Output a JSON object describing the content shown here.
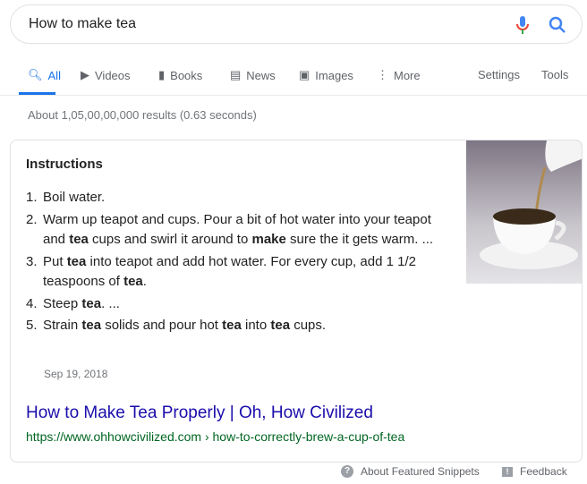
{
  "search": {
    "query": "How to make tea"
  },
  "tabs": [
    {
      "label": "All",
      "icon": "search-icon",
      "active": true
    },
    {
      "label": "Videos",
      "icon": "video-icon"
    },
    {
      "label": "Books",
      "icon": "book-icon"
    },
    {
      "label": "News",
      "icon": "news-icon"
    },
    {
      "label": "Images",
      "icon": "image-icon"
    },
    {
      "label": "More",
      "icon": "more-vert-icon"
    }
  ],
  "tools": {
    "settings": "Settings",
    "tools": "Tools"
  },
  "result_stats": "About 1,05,00,00,000 results (0.63 seconds)",
  "snippet": {
    "heading": "Instructions",
    "steps": [
      [
        {
          "t": "Boil water."
        }
      ],
      [
        {
          "t": "Warm up teapot and cups. Pour a bit of hot water into your teapot and "
        },
        {
          "t": "tea",
          "b": true
        },
        {
          "t": " cups and swirl it around to "
        },
        {
          "t": "make",
          "b": true
        },
        {
          "t": " sure the it gets warm. ..."
        }
      ],
      [
        {
          "t": "Put "
        },
        {
          "t": "tea",
          "b": true
        },
        {
          "t": " into teapot and add hot water. For every cup, add 1 1/2 teaspoons of "
        },
        {
          "t": "tea",
          "b": true
        },
        {
          "t": "."
        }
      ],
      [
        {
          "t": "Steep "
        },
        {
          "t": "tea",
          "b": true
        },
        {
          "t": ". ..."
        }
      ],
      [
        {
          "t": "Strain "
        },
        {
          "t": "tea",
          "b": true
        },
        {
          "t": " solids and pour hot "
        },
        {
          "t": "tea",
          "b": true
        },
        {
          "t": " into "
        },
        {
          "t": "tea",
          "b": true
        },
        {
          "t": " cups."
        }
      ]
    ],
    "date": "Sep 19, 2018",
    "title": "How to Make Tea Properly | Oh, How Civilized",
    "url": "https://www.ohhowcivilized.com › how-to-correctly-brew-a-cup-of-tea"
  },
  "footer": {
    "about": "About Featured Snippets",
    "feedback": "Feedback"
  },
  "colors": {
    "accent": "#1a73e8",
    "link": "#1a0dab",
    "url": "#006621"
  }
}
